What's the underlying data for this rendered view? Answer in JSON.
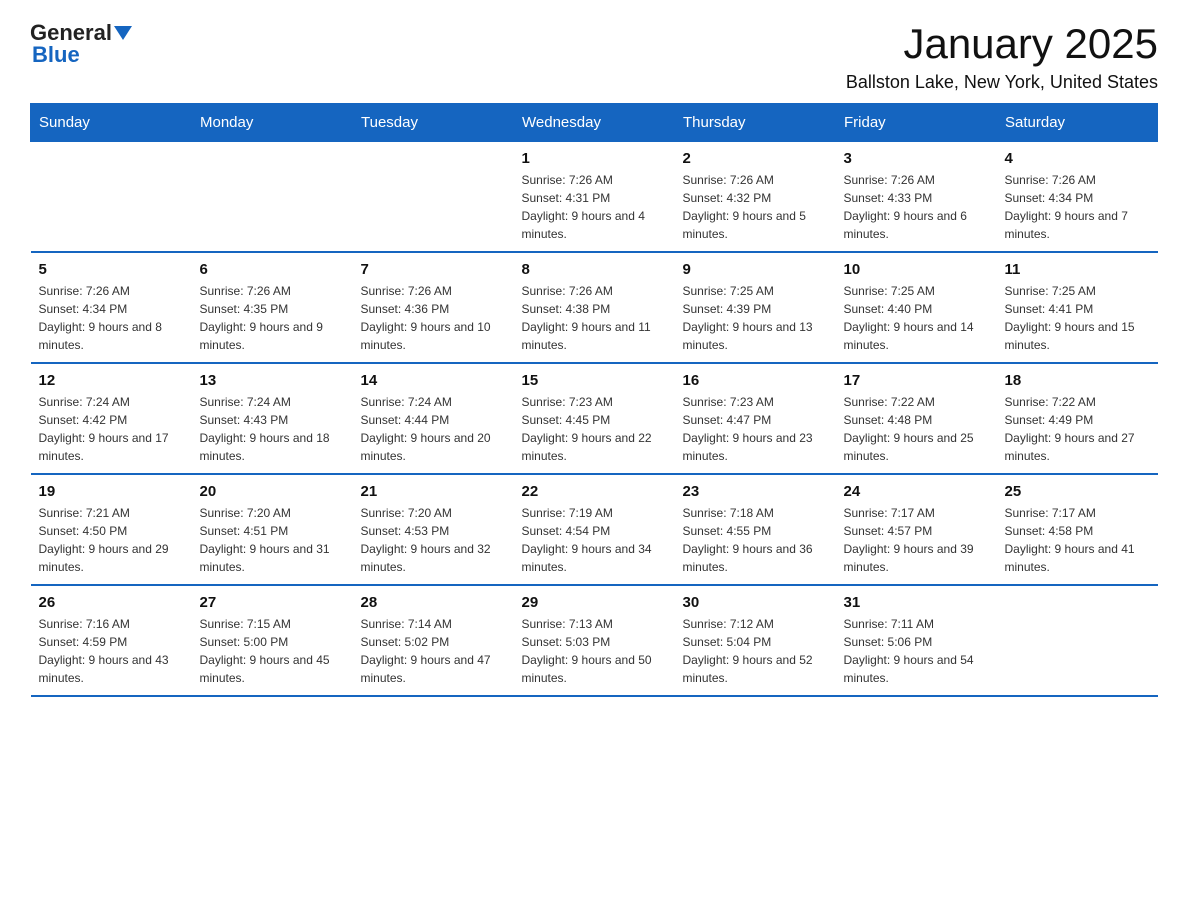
{
  "header": {
    "logo_general": "General",
    "logo_blue": "Blue",
    "title": "January 2025",
    "subtitle": "Ballston Lake, New York, United States"
  },
  "weekdays": [
    "Sunday",
    "Monday",
    "Tuesday",
    "Wednesday",
    "Thursday",
    "Friday",
    "Saturday"
  ],
  "weeks": [
    [
      {
        "day": "",
        "info": ""
      },
      {
        "day": "",
        "info": ""
      },
      {
        "day": "",
        "info": ""
      },
      {
        "day": "1",
        "info": "Sunrise: 7:26 AM\nSunset: 4:31 PM\nDaylight: 9 hours and 4 minutes."
      },
      {
        "day": "2",
        "info": "Sunrise: 7:26 AM\nSunset: 4:32 PM\nDaylight: 9 hours and 5 minutes."
      },
      {
        "day": "3",
        "info": "Sunrise: 7:26 AM\nSunset: 4:33 PM\nDaylight: 9 hours and 6 minutes."
      },
      {
        "day": "4",
        "info": "Sunrise: 7:26 AM\nSunset: 4:34 PM\nDaylight: 9 hours and 7 minutes."
      }
    ],
    [
      {
        "day": "5",
        "info": "Sunrise: 7:26 AM\nSunset: 4:34 PM\nDaylight: 9 hours and 8 minutes."
      },
      {
        "day": "6",
        "info": "Sunrise: 7:26 AM\nSunset: 4:35 PM\nDaylight: 9 hours and 9 minutes."
      },
      {
        "day": "7",
        "info": "Sunrise: 7:26 AM\nSunset: 4:36 PM\nDaylight: 9 hours and 10 minutes."
      },
      {
        "day": "8",
        "info": "Sunrise: 7:26 AM\nSunset: 4:38 PM\nDaylight: 9 hours and 11 minutes."
      },
      {
        "day": "9",
        "info": "Sunrise: 7:25 AM\nSunset: 4:39 PM\nDaylight: 9 hours and 13 minutes."
      },
      {
        "day": "10",
        "info": "Sunrise: 7:25 AM\nSunset: 4:40 PM\nDaylight: 9 hours and 14 minutes."
      },
      {
        "day": "11",
        "info": "Sunrise: 7:25 AM\nSunset: 4:41 PM\nDaylight: 9 hours and 15 minutes."
      }
    ],
    [
      {
        "day": "12",
        "info": "Sunrise: 7:24 AM\nSunset: 4:42 PM\nDaylight: 9 hours and 17 minutes."
      },
      {
        "day": "13",
        "info": "Sunrise: 7:24 AM\nSunset: 4:43 PM\nDaylight: 9 hours and 18 minutes."
      },
      {
        "day": "14",
        "info": "Sunrise: 7:24 AM\nSunset: 4:44 PM\nDaylight: 9 hours and 20 minutes."
      },
      {
        "day": "15",
        "info": "Sunrise: 7:23 AM\nSunset: 4:45 PM\nDaylight: 9 hours and 22 minutes."
      },
      {
        "day": "16",
        "info": "Sunrise: 7:23 AM\nSunset: 4:47 PM\nDaylight: 9 hours and 23 minutes."
      },
      {
        "day": "17",
        "info": "Sunrise: 7:22 AM\nSunset: 4:48 PM\nDaylight: 9 hours and 25 minutes."
      },
      {
        "day": "18",
        "info": "Sunrise: 7:22 AM\nSunset: 4:49 PM\nDaylight: 9 hours and 27 minutes."
      }
    ],
    [
      {
        "day": "19",
        "info": "Sunrise: 7:21 AM\nSunset: 4:50 PM\nDaylight: 9 hours and 29 minutes."
      },
      {
        "day": "20",
        "info": "Sunrise: 7:20 AM\nSunset: 4:51 PM\nDaylight: 9 hours and 31 minutes."
      },
      {
        "day": "21",
        "info": "Sunrise: 7:20 AM\nSunset: 4:53 PM\nDaylight: 9 hours and 32 minutes."
      },
      {
        "day": "22",
        "info": "Sunrise: 7:19 AM\nSunset: 4:54 PM\nDaylight: 9 hours and 34 minutes."
      },
      {
        "day": "23",
        "info": "Sunrise: 7:18 AM\nSunset: 4:55 PM\nDaylight: 9 hours and 36 minutes."
      },
      {
        "day": "24",
        "info": "Sunrise: 7:17 AM\nSunset: 4:57 PM\nDaylight: 9 hours and 39 minutes."
      },
      {
        "day": "25",
        "info": "Sunrise: 7:17 AM\nSunset: 4:58 PM\nDaylight: 9 hours and 41 minutes."
      }
    ],
    [
      {
        "day": "26",
        "info": "Sunrise: 7:16 AM\nSunset: 4:59 PM\nDaylight: 9 hours and 43 minutes."
      },
      {
        "day": "27",
        "info": "Sunrise: 7:15 AM\nSunset: 5:00 PM\nDaylight: 9 hours and 45 minutes."
      },
      {
        "day": "28",
        "info": "Sunrise: 7:14 AM\nSunset: 5:02 PM\nDaylight: 9 hours and 47 minutes."
      },
      {
        "day": "29",
        "info": "Sunrise: 7:13 AM\nSunset: 5:03 PM\nDaylight: 9 hours and 50 minutes."
      },
      {
        "day": "30",
        "info": "Sunrise: 7:12 AM\nSunset: 5:04 PM\nDaylight: 9 hours and 52 minutes."
      },
      {
        "day": "31",
        "info": "Sunrise: 7:11 AM\nSunset: 5:06 PM\nDaylight: 9 hours and 54 minutes."
      },
      {
        "day": "",
        "info": ""
      }
    ]
  ]
}
